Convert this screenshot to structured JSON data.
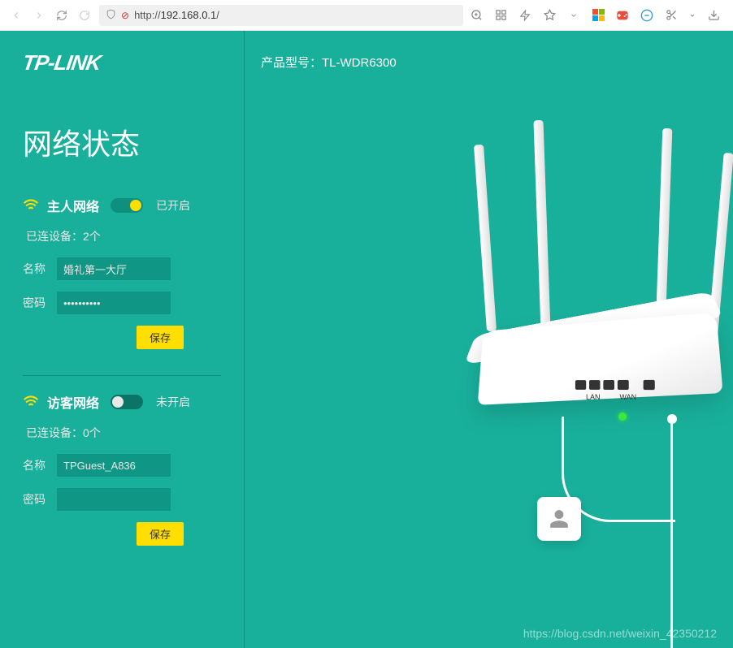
{
  "browser": {
    "url_prefix": "http://",
    "url_host": "192.168.0.1",
    "url_path": "/"
  },
  "logo": "TP-LINK",
  "model_label": "产品型号：",
  "model_value": "TL-WDR6300",
  "page_title": "网络状态",
  "host_network": {
    "title": "主人网络",
    "status": "已开启",
    "devices_label": "已连设备：",
    "devices_count": "2个",
    "name_label": "名称",
    "name_value": "婚礼第一大厅",
    "password_label": "密码",
    "password_value": "••••••••••",
    "save": "保存"
  },
  "guest_network": {
    "title": "访客网络",
    "status": "未开启",
    "devices_label": "已连设备：",
    "devices_count": "0个",
    "name_label": "名称",
    "name_value": "TPGuest_A836",
    "password_label": "密码",
    "password_value": "",
    "save": "保存"
  },
  "ports": {
    "lan": "LAN",
    "wan": "WAN"
  },
  "watermark": "https://blog.csdn.net/weixin_42350212"
}
